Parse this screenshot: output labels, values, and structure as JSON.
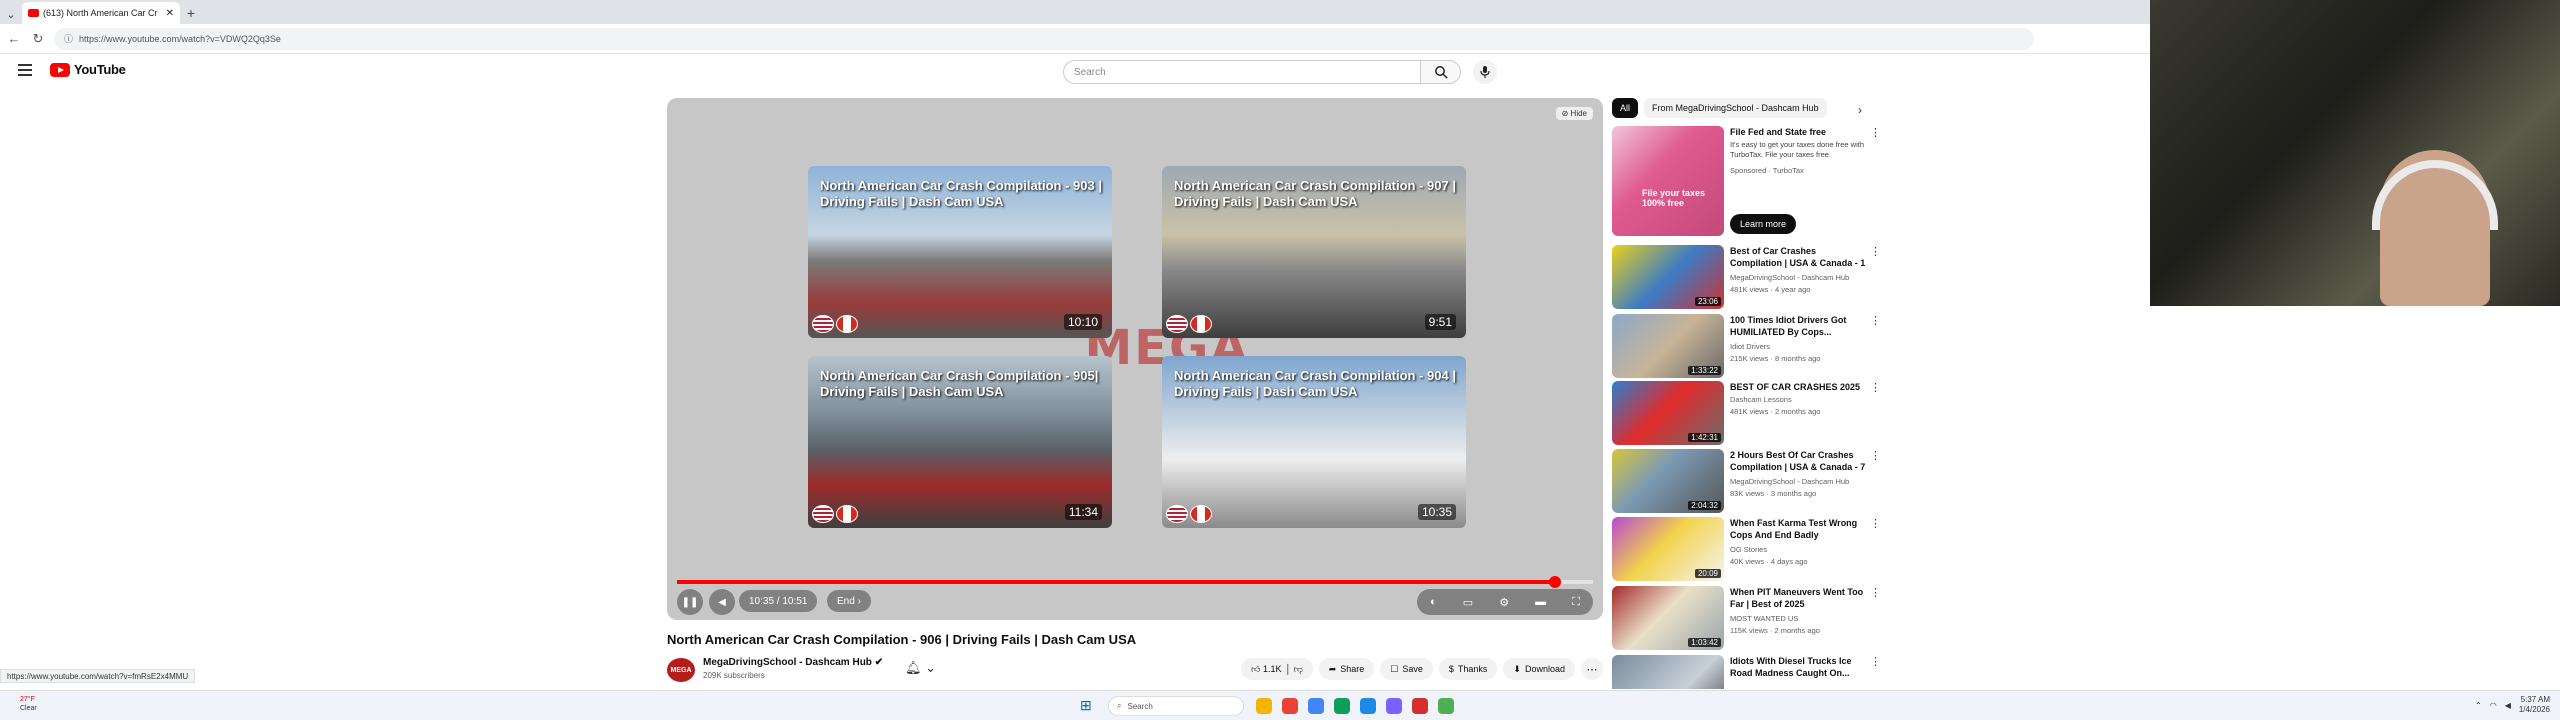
{
  "browser": {
    "tab_title": "(613) North American Car Cr",
    "new_tab": "+",
    "url": "https://www.youtube.com/watch?v=VDWQ2Qq3Se",
    "status_url": "https://www.youtube.com/watch?v=fmRsE2x4MMU"
  },
  "header": {
    "logo_text": "YouTube",
    "search_placeholder": "Search"
  },
  "player": {
    "hide_label": "Hide",
    "watermark": "MEGA",
    "progress_fraction": 0.958,
    "time": "10:35 / 10:51",
    "end_label": "End ›",
    "end_screen": [
      {
        "title": "North American Car Crash Compilation - 903 | Driving Fails | Dash Cam USA",
        "duration": "10:10"
      },
      {
        "title": "North American Car Crash Compilation - 907 | Driving Fails | Dash Cam USA",
        "duration": "9:51"
      },
      {
        "title": "North American Car Crash Compilation - 905| Driving Fails | Dash Cam USA",
        "duration": "11:34"
      },
      {
        "title": "North American Car Crash Compilation - 904 | Driving Fails | Dash Cam USA",
        "duration": "10:35"
      }
    ]
  },
  "video": {
    "title": "North American Car Crash Compilation - 906 | Driving Fails | Dash Cam USA",
    "channel": "MegaDrivingSchool - Dashcam Hub",
    "subscribers": "209K subscribers",
    "avatar_text": "MEGA",
    "likes": "1.1K",
    "share": "Share",
    "save": "Save",
    "thanks": "Thanks",
    "download": "Download"
  },
  "sidebar": {
    "chips": [
      "All",
      "From MegaDrivingSchool - Dashcam Hub"
    ],
    "ad": {
      "title": "File Fed and State free",
      "text": "It's easy to get your taxes done free with TurboTax. File your taxes free.",
      "sponsored": "Sponsored · TurboTax",
      "button": "Learn more"
    },
    "items": [
      {
        "title": "Best of Car Crashes Compilation | USA & Canada - 1",
        "channel": "MegaDrivingSchool - Dashcam Hub",
        "meta": "481K views · 4 year ago",
        "duration": "23:06"
      },
      {
        "title": "100 Times Idiot Drivers Got HUMILIATED By Cops...",
        "channel": "Idiot Drivers",
        "meta": "215K views · 8 months ago",
        "duration": "1:33:22"
      },
      {
        "title": "BEST OF CAR CRASHES 2025",
        "channel": "Dashcam Lessons",
        "meta": "481K views · 2 months ago",
        "duration": "1:42:31"
      },
      {
        "title": "2 Hours Best Of Car Crashes Compilation | USA & Canada - 7",
        "channel": "MegaDrivingSchool - Dashcam Hub",
        "meta": "83K views · 3 months ago",
        "duration": "2:04:32"
      },
      {
        "title": "When Fast Karma Test Wrong Cops And End Badly",
        "channel": "OG Stories",
        "meta": "40K views · 4 days ago",
        "duration": "20:09"
      },
      {
        "title": "When PIT Maneuvers Went Too Far | Best of 2025",
        "channel": "MOST WANTED US",
        "meta": "115K views · 2 months ago",
        "duration": "1:03:42"
      },
      {
        "title": "Idiots With Diesel Trucks Ice Road Madness Caught On...",
        "channel": "",
        "meta": "",
        "duration": ""
      }
    ]
  },
  "taskbar": {
    "temp": "27°F",
    "condition": "Clear",
    "search": "Search",
    "time": "5:37 AM",
    "date": "1/4/2026"
  },
  "colors": {
    "accent": "#ff0000",
    "chip_active": "#0f0f0f"
  }
}
